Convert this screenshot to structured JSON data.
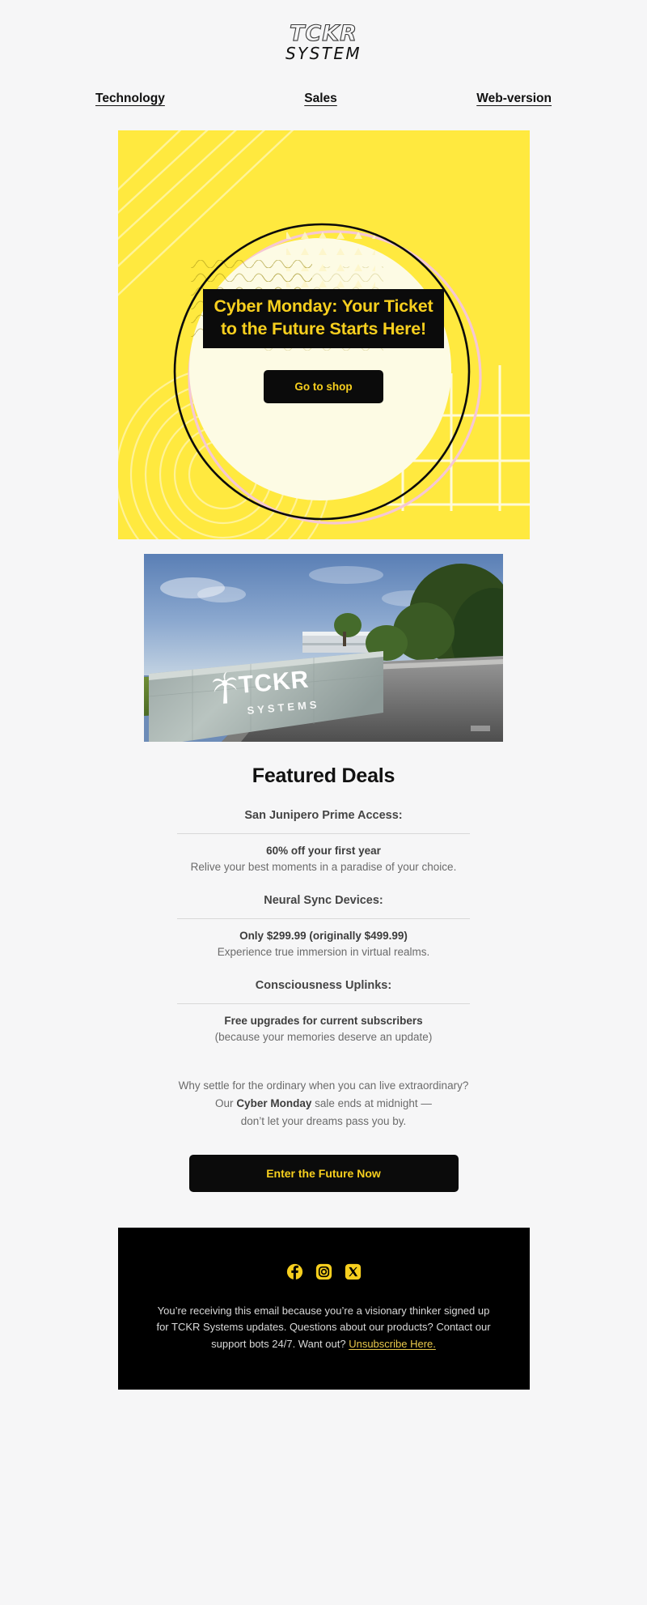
{
  "brand": {
    "logo_top": "TCKR",
    "logo_bottom": "SYSTEM"
  },
  "nav": {
    "items": [
      {
        "label": "Technology"
      },
      {
        "label": "Sales"
      },
      {
        "label": "Web-version"
      }
    ]
  },
  "hero": {
    "background_color": "#ffe93f",
    "headline_line1": "Cyber Monday: Your Ticket",
    "headline_line2": "to the Future Starts Here!",
    "headline_bg": "#0b0b0b",
    "headline_color": "#f7cf1e",
    "cta_label": "Go to shop"
  },
  "photo": {
    "sign_brand": "TCKR",
    "sign_sub": "SYSTEMS",
    "alt": "TCKR Systems corporate campus entrance sign beside a road"
  },
  "deals": {
    "title": "Featured Deals",
    "items": [
      {
        "name": "San Junipero Prime Access:",
        "price": "60% off your first year",
        "description": "Relive your best moments in a paradise of your choice."
      },
      {
        "name": "Neural Sync Devices:",
        "price": "Only $299.99 (originally $499.99)",
        "description": "Experience true immersion in virtual realms."
      },
      {
        "name": "Consciousness Uplinks:",
        "price": "Free upgrades for current subscribers",
        "description": "(because your memories deserve an update)"
      }
    ]
  },
  "closing": {
    "line1": "Why settle for the ordinary when you can live extraordinary?",
    "line2_pre": "Our ",
    "line2_bold": "Cyber Monday",
    "line2_post": " sale ends at midnight —",
    "line3": "don’t let your dreams pass you by.",
    "cta_label": "Enter the Future Now"
  },
  "footer": {
    "background_color": "#000000",
    "accent_color": "#f7cf1e",
    "socials": [
      {
        "name": "facebook"
      },
      {
        "name": "instagram"
      },
      {
        "name": "x-twitter"
      }
    ],
    "text_pre": "You’re receiving this email because you’re a visionary thinker signed up for TCKR Systems updates. Questions about our products? Contact our support bots 24/7. Want out? ",
    "unsubscribe_label": "Unsubscribe Here."
  }
}
